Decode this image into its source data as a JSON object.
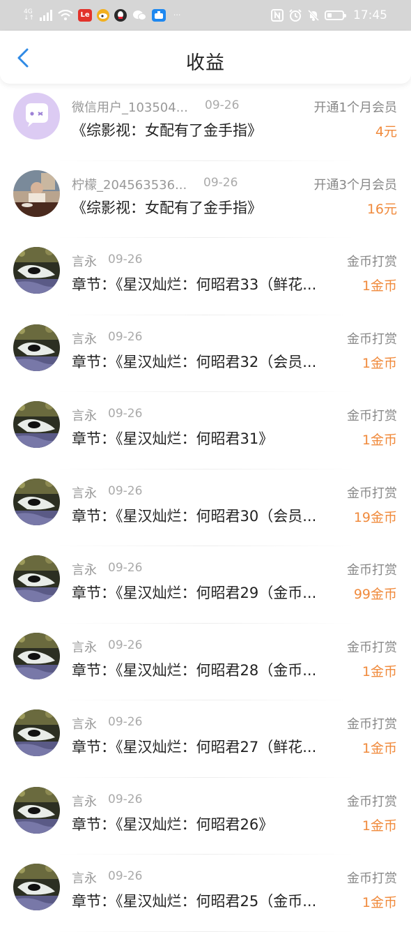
{
  "status_bar": {
    "network": "4G",
    "le_icon": "Le",
    "time": "17:45",
    "more": "···"
  },
  "header": {
    "title": "收益",
    "back_icon": "chevron-left-icon"
  },
  "colors": {
    "accent_amount": "#f08a3c",
    "back_arrow": "#2f8ae5",
    "wechat_avatar": "#d9c7f2"
  },
  "records": [
    {
      "user": "微信用户_103504...",
      "date": "09-26",
      "kind": "开通1个月会员",
      "title": "《综影视：女配有了金手指》",
      "amount": "4元",
      "avatar": "wechat"
    },
    {
      "user": "柠檬_204563536...",
      "date": "09-26",
      "kind": "开通3个月会员",
      "title": "《综影视：女配有了金手指》",
      "amount": "16元",
      "avatar": "photo"
    },
    {
      "user": "言永",
      "date": "09-26",
      "kind": "金币打赏",
      "title": "章节：《星汉灿烂：何昭君33（鲜花...",
      "amount": "1金币",
      "avatar": "cat"
    },
    {
      "user": "言永",
      "date": "09-26",
      "kind": "金币打赏",
      "title": "章节：《星汉灿烂：何昭君32（会员...",
      "amount": "1金币",
      "avatar": "cat"
    },
    {
      "user": "言永",
      "date": "09-26",
      "kind": "金币打赏",
      "title": "章节：《星汉灿烂：何昭君31》",
      "amount": "1金币",
      "avatar": "cat"
    },
    {
      "user": "言永",
      "date": "09-26",
      "kind": "金币打赏",
      "title": "章节：《星汉灿烂：何昭君30（会员...",
      "amount": "19金币",
      "avatar": "cat"
    },
    {
      "user": "言永",
      "date": "09-26",
      "kind": "金币打赏",
      "title": "章节：《星汉灿烂：何昭君29（金币...",
      "amount": "99金币",
      "avatar": "cat"
    },
    {
      "user": "言永",
      "date": "09-26",
      "kind": "金币打赏",
      "title": "章节：《星汉灿烂：何昭君28（金币...",
      "amount": "1金币",
      "avatar": "cat"
    },
    {
      "user": "言永",
      "date": "09-26",
      "kind": "金币打赏",
      "title": "章节：《星汉灿烂：何昭君27（鲜花...",
      "amount": "1金币",
      "avatar": "cat"
    },
    {
      "user": "言永",
      "date": "09-26",
      "kind": "金币打赏",
      "title": "章节：《星汉灿烂：何昭君26》",
      "amount": "1金币",
      "avatar": "cat"
    },
    {
      "user": "言永",
      "date": "09-26",
      "kind": "金币打赏",
      "title": "章节：《星汉灿烂：何昭君25（金币...",
      "amount": "1金币",
      "avatar": "cat"
    }
  ]
}
